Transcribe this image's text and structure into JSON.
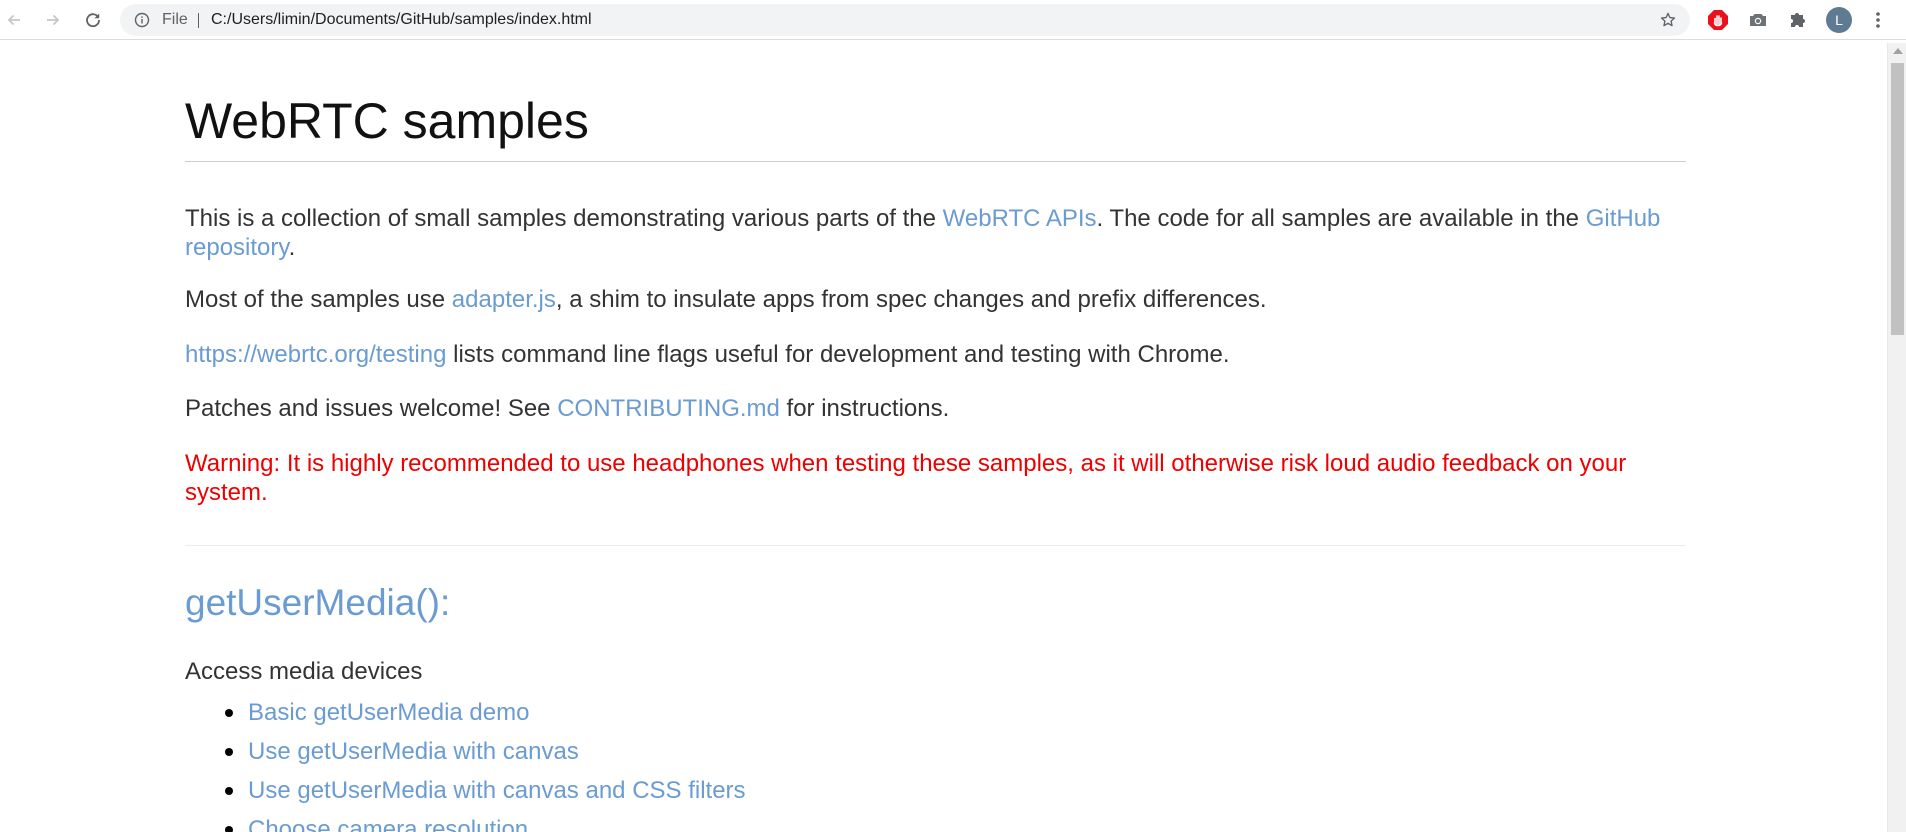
{
  "browser": {
    "scheme_label": "File",
    "url": "C:/Users/limin/Documents/GitHub/samples/index.html",
    "profile_initial": "L",
    "icons": {
      "back": "arrow-left-icon",
      "forward": "arrow-right-icon",
      "reload": "reload-icon",
      "info": "info-icon",
      "bookmark": "star-icon",
      "adblock": "adblock-icon",
      "screenshot": "camera-icon",
      "extensions": "puzzle-icon",
      "menu": "kebab-menu-icon"
    },
    "colors": {
      "adblock": "#e8111c",
      "avatar": "#5f7a93"
    }
  },
  "page": {
    "title": "WebRTC samples",
    "intro": {
      "before": "This is a collection of small samples demonstrating various parts of the ",
      "link1": "WebRTC APIs",
      "middle": ". The code for all samples are available in the ",
      "link2": "GitHub repository",
      "after": "."
    },
    "adapter": {
      "before": "Most of the samples use ",
      "link": "adapter.js",
      "after": ", a shim to insulate apps from spec changes and prefix differences."
    },
    "testing": {
      "link": "https://webrtc.org/testing",
      "after": " lists command line flags useful for development and testing with Chrome."
    },
    "patches": {
      "before": "Patches and issues welcome! See ",
      "link": "CONTRIBUTING.md",
      "after": " for instructions."
    },
    "warning": "Warning: It is highly recommended to use headphones when testing these samples, as it will otherwise risk loud audio feedback on your system.",
    "section": {
      "heading": "getUserMedia():",
      "description": "Access media devices",
      "items": [
        "Basic getUserMedia demo",
        "Use getUserMedia with canvas",
        "Use getUserMedia with canvas and CSS filters",
        "Choose camera resolution"
      ]
    },
    "colors": {
      "link": "#6a9bd2",
      "warning": "#ee0000",
      "text": "#333333"
    }
  }
}
